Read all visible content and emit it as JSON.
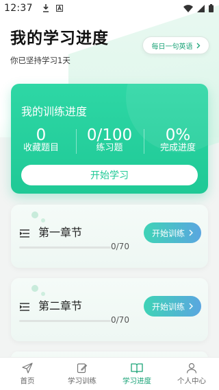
{
  "status_bar": {
    "time": "12:37",
    "icons_left": [
      "download-icon",
      "a-letter-icon"
    ],
    "icons_right": [
      "wifi-icon",
      "signal-icon",
      "battery-icon"
    ]
  },
  "header": {
    "title": "我的学习进度",
    "subtitle": "你已坚持学习1天",
    "daily_english_label": "每日一句英语"
  },
  "progress_card": {
    "title": "我的训练进度",
    "stats": [
      {
        "value": "0",
        "label": "收藏题目"
      },
      {
        "value": "0/100",
        "label": "练习题"
      },
      {
        "value": "0%",
        "label": "完成进度"
      }
    ],
    "start_button_label": "开始学习"
  },
  "chapters": [
    {
      "title": "第一章节",
      "progress_text": "0/70",
      "progress_fraction": 0,
      "button_label": "开始训练"
    },
    {
      "title": "第二章节",
      "progress_text": "0/70",
      "progress_fraction": 0,
      "button_label": "开始训练"
    }
  ],
  "tabbar": {
    "tabs": [
      {
        "label": "首页",
        "icon": "send-icon",
        "active": false
      },
      {
        "label": "学习训练",
        "icon": "edit-icon",
        "active": false
      },
      {
        "label": "学习进度",
        "icon": "book-icon",
        "active": true
      },
      {
        "label": "个人中心",
        "icon": "person-icon",
        "active": false
      }
    ]
  },
  "colors": {
    "accent": "#1fc996",
    "accent_dark": "#1aa377",
    "button_gradient_start": "#3fd3b6",
    "button_gradient_end": "#5aa6e0"
  }
}
